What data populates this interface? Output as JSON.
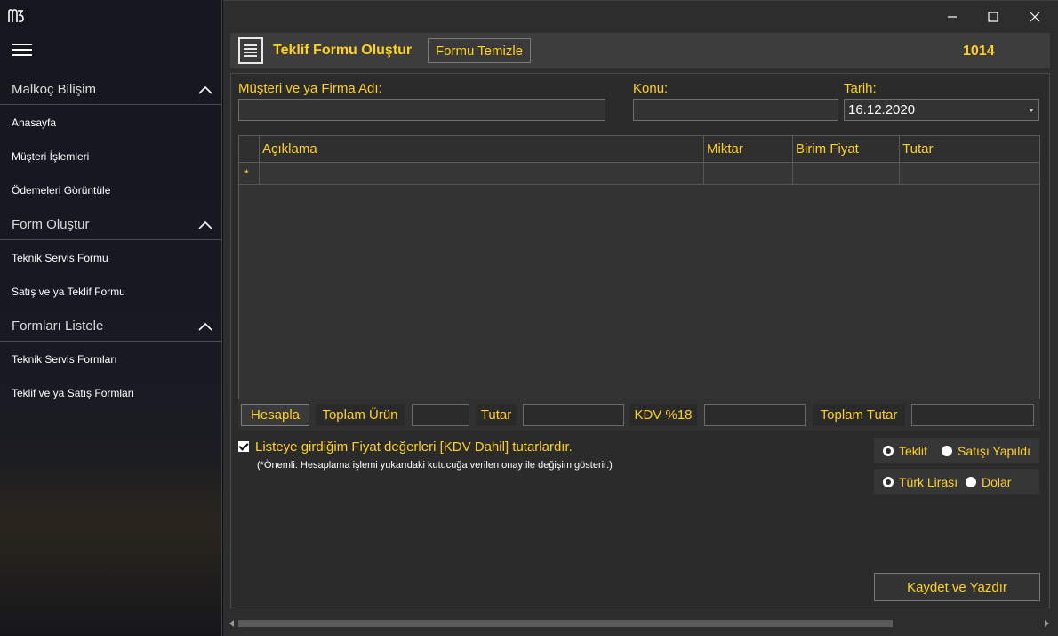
{
  "sidebar": {
    "logo_icon": "m3-logo",
    "menu_icon": "hamburger-icon",
    "sections": [
      {
        "title": "Malkoç Bilişim",
        "items": [
          "Anasayfa",
          "Müşteri İşlemleri",
          "Ödemeleri Görüntüle"
        ]
      },
      {
        "title": "Form Oluştur",
        "items": [
          "Teknik Servis Formu",
          "Satış ve ya Teklif Formu"
        ]
      },
      {
        "title": "Formları Listele",
        "items": [
          "Teknik Servis Formları",
          "Teklif ve ya Satış Formları"
        ]
      }
    ]
  },
  "window": {
    "controls": [
      "minimize",
      "maximize",
      "close"
    ]
  },
  "header": {
    "title": "Teklif Formu Oluştur",
    "clear_button": "Formu Temizle",
    "form_number": "1014",
    "accent_color": "#ffd21f"
  },
  "form": {
    "customer_label": "Müşteri ve ya Firma Adı:",
    "customer_value": "",
    "subject_label": "Konu:",
    "subject_value": "",
    "date_label": "Tarih:",
    "date_value": "16.12.2020"
  },
  "grid": {
    "columns": [
      "Açıklama",
      "Miktar",
      "Birim Fiyat",
      "Tutar"
    ],
    "new_row_marker": "*"
  },
  "totals": {
    "calc_button": "Hesapla",
    "total_products_label": "Toplam Ürün",
    "amount_label": "Tutar",
    "vat_label": "KDV %18",
    "grand_total_label": "Toplam Tutar"
  },
  "options": {
    "vat_included_checked": true,
    "vat_included_label": "Listeye girdiğim Fiyat değerleri [KDV Dahil] tutarlardır.",
    "note": "(*Önemli: Hesaplama işlemi yukarıdaki kutucuğa verilen onay ile değişim gösterir.)",
    "type_options": [
      "Teklif",
      "Satışı Yapıldı"
    ],
    "type_selected": "Teklif",
    "currency_options": [
      "Türk Lirası",
      "Dolar"
    ],
    "currency_selected": "Türk Lirası"
  },
  "actions": {
    "save_print_button": "Kaydet ve Yazdır"
  }
}
